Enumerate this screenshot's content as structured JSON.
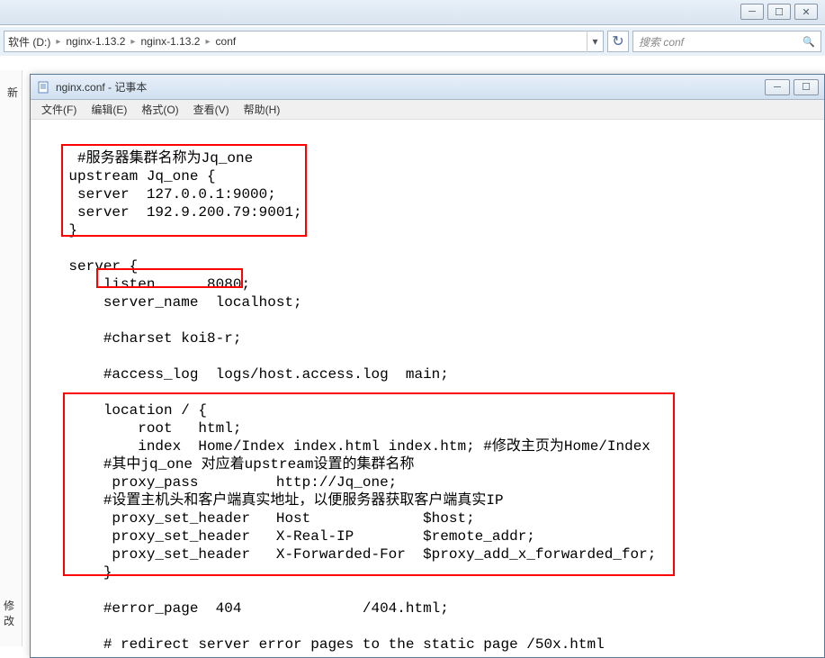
{
  "explorer": {
    "breadcrumb": {
      "seg1": "软件 (D:)",
      "seg2": "nginx-1.13.2",
      "seg3": "nginx-1.13.2",
      "seg4": "conf"
    },
    "search_placeholder": "搜索 conf"
  },
  "sidebar": {
    "item1": "新",
    "item2": "修改"
  },
  "notepad": {
    "title": "nginx.conf - 记事本",
    "menu": {
      "file": "文件(F)",
      "edit": "编辑(E)",
      "format": "格式(O)",
      "view": "查看(V)",
      "help": "帮助(H)"
    },
    "content": "\n     #服务器集群名称为Jq_one\n    upstream Jq_one {\n     server  127.0.0.1:9000;\n     server  192.9.200.79:9001;\n    }\n\n    server {\n        listen      8080;\n        server_name  localhost;\n\n        #charset koi8-r;\n\n        #access_log  logs/host.access.log  main;\n\n        location / {\n            root   html;\n            index  Home/Index index.html index.htm; #修改主页为Home/Index\n        #其中jq_one 对应着upstream设置的集群名称\n         proxy_pass         http://Jq_one;\n        #设置主机头和客户端真实地址，以便服务器获取客户端真实IP\n         proxy_set_header   Host             $host;\n         proxy_set_header   X-Real-IP        $remote_addr;\n         proxy_set_header   X-Forwarded-For  $proxy_add_x_forwarded_for;\n        }\n\n        #error_page  404              /404.html;\n\n        # redirect server error pages to the static page /50x.html"
  }
}
